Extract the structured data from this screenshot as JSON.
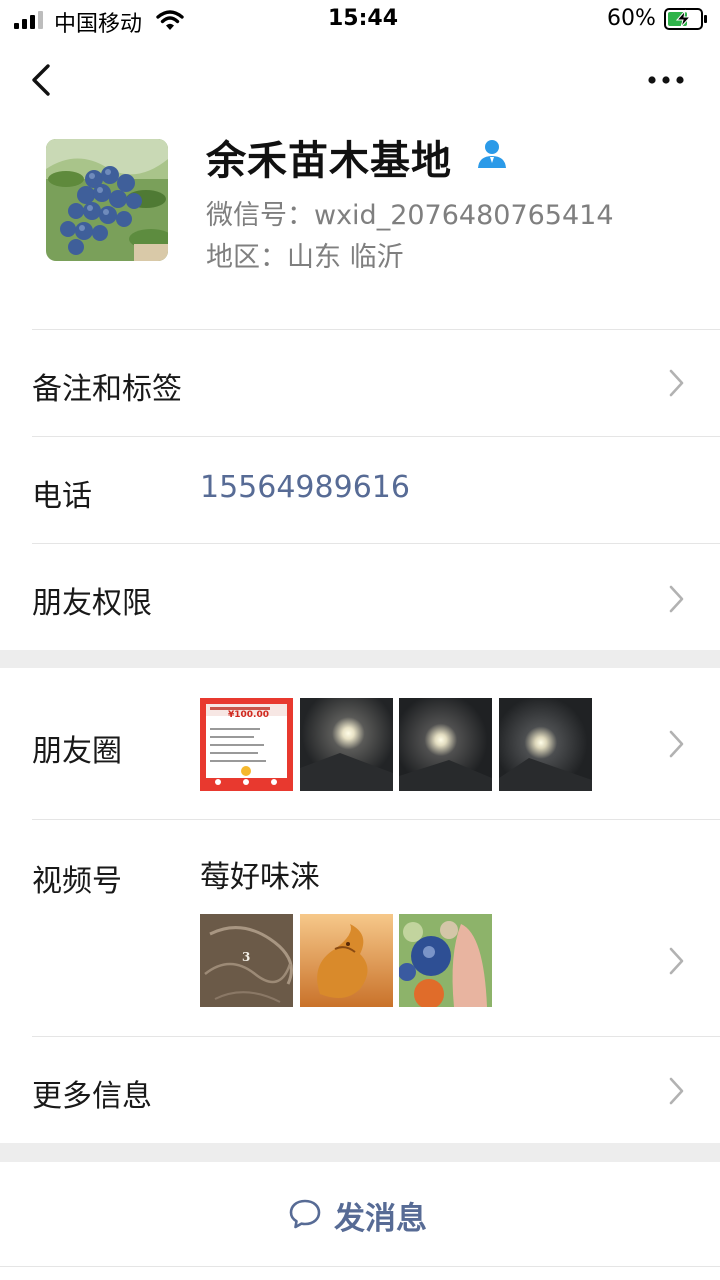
{
  "status_bar": {
    "carrier": "中国移动",
    "time": "15:44",
    "battery": "60%",
    "battery_level": 0.6,
    "battery_color": "#2fb34a",
    "icons": [
      "signal-icon",
      "wifi-icon",
      "battery-charging-icon"
    ]
  },
  "nav": {
    "back_icon": "chevron-left-icon",
    "more_icon": "more-dots-icon"
  },
  "profile": {
    "name": "余禾苗木基地",
    "wechat_id": "微信号：wxid_2076480765414",
    "region": "地区：山东 临沂",
    "verified_icon": "person-badge-icon",
    "avatar": "blueberry-photo"
  },
  "rows": {
    "remarks": "备注和标签",
    "phone_label": "电话",
    "phone_value": "15564989616",
    "permissions": "朋友权限",
    "moments": "朋友圈",
    "channels": "视频号",
    "channel_name": "莓好味涞",
    "more_info": "更多信息"
  },
  "moments_thumbs": [
    "red-payment-screenshot",
    "moon-night-photo",
    "moon-night-photo",
    "moon-night-photo"
  ],
  "moments_thumb_text": {
    "amount": "¥100.00"
  },
  "channel_thumbs": [
    "dragon-sketch",
    "golden-dragon",
    "blueberries-in-hand"
  ],
  "channel_thumb_text": {
    "number": "3"
  },
  "actions": {
    "send_message": "发消息",
    "send_icon": "chat-bubble-icon"
  },
  "colors": {
    "link": "#576b95",
    "verified": "#2b9ae8",
    "gap": "#ededed"
  }
}
